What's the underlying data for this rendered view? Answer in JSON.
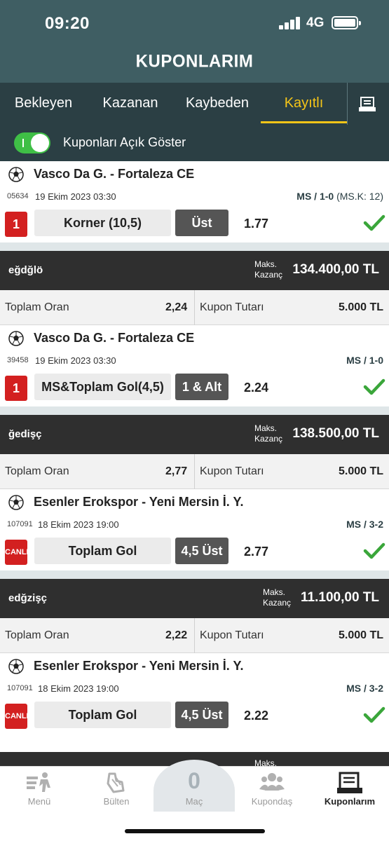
{
  "status_bar": {
    "time": "09:20",
    "network": "4G"
  },
  "header": {
    "title": "KUPONLARIM"
  },
  "tabs": [
    {
      "label": "Bekleyen"
    },
    {
      "label": "Kazanan"
    },
    {
      "label": "Kaybeden"
    },
    {
      "label": "Kayıtlı",
      "active": true
    }
  ],
  "toggle": {
    "label": "Kuponları Açık Göster",
    "on": true
  },
  "matches": [
    {
      "teams": "Vasco Da G. - Fortaleza CE",
      "code": "05634",
      "date": "19 Ekim 2023 03:30",
      "result": "MS / 1-0",
      "result_extra": " (MS.K: 12)",
      "badge": "1",
      "market": "Korner (10,5)",
      "pick": "Üst",
      "odd": "1.77"
    },
    {
      "teams": "Vasco Da G. - Fortaleza CE",
      "code": "39458",
      "date": "19 Ekim 2023 03:30",
      "result": "MS / 1-0",
      "result_extra": "",
      "badge": "1",
      "market": "MS&Toplam Gol(4,5)",
      "pick": "1 & Alt",
      "odd": "2.24"
    },
    {
      "teams": "Esenler Erokspor - Yeni Mersin İ. Y.",
      "code": "107091",
      "date": "18 Ekim 2023 19:00",
      "result": "MS / 3-2",
      "result_extra": "",
      "badge": "CANLI",
      "market": "Toplam Gol",
      "pick": "4,5 Üst",
      "odd": "2.77"
    },
    {
      "teams": "Esenler Erokspor - Yeni Mersin İ. Y.",
      "code": "107091",
      "date": "18 Ekim 2023 19:00",
      "result": "MS / 3-2",
      "result_extra": "",
      "badge": "CANLI",
      "market": "Toplam Gol",
      "pick": "4,5 Üst",
      "odd": "2.22"
    }
  ],
  "coupons": [
    {
      "name": "eğdğlö",
      "maks_label_1": "Maks.",
      "maks_label_2": "Kazanç",
      "amount": "134.400,00 TL",
      "total_odds_label": "Toplam Oran",
      "total_odds": "2,24",
      "stake_label": "Kupon Tutarı",
      "stake": "5.000 TL"
    },
    {
      "name": "ğedişç",
      "maks_label_1": "Maks.",
      "maks_label_2": "Kazanç",
      "amount": "138.500,00 TL",
      "total_odds_label": "Toplam Oran",
      "total_odds": "2,77",
      "stake_label": "Kupon Tutarı",
      "stake": "5.000 TL"
    },
    {
      "name": "edğzişç",
      "maks_label_1": "Maks.",
      "maks_label_2": "Kazanç",
      "amount": "11.100,00 TL",
      "total_odds_label": "Toplam Oran",
      "total_odds": "2,22",
      "stake_label": "Kupon Tutarı",
      "stake": "5.000 TL"
    }
  ],
  "partial_label": "Maks.",
  "bottom_nav": {
    "menu": "Menü",
    "bulletin": "Bülten",
    "match_count": "0",
    "match_label": "Maç",
    "kupondas": "Kupondaş",
    "kuponlarim": "Kuponlarım"
  },
  "colors": {
    "header_bg": "#3f5e63",
    "tabs_bg": "#2b3f44",
    "accent": "#f5c518",
    "toggle_on": "#3fbf46",
    "badge_red": "#d32020",
    "check_green": "#3aa63a"
  }
}
